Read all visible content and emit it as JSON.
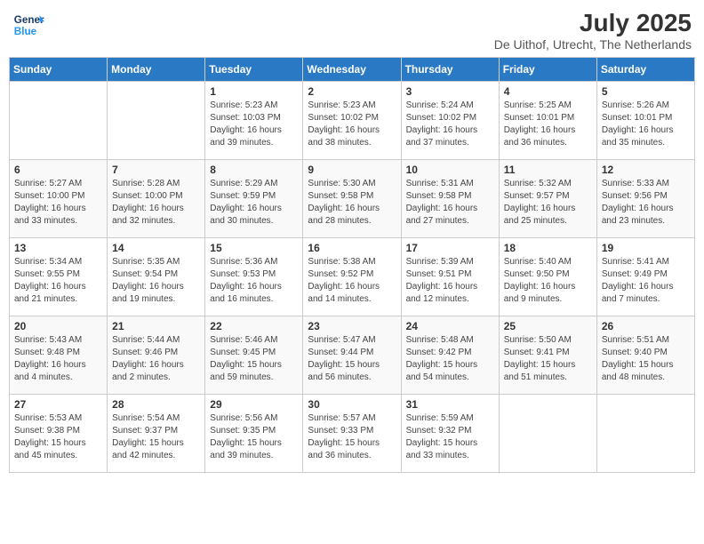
{
  "header": {
    "logo_line1": "General",
    "logo_line2": "Blue",
    "month_year": "July 2025",
    "location": "De Uithof, Utrecht, The Netherlands"
  },
  "days_of_week": [
    "Sunday",
    "Monday",
    "Tuesday",
    "Wednesday",
    "Thursday",
    "Friday",
    "Saturday"
  ],
  "weeks": [
    [
      {
        "day": "",
        "content": ""
      },
      {
        "day": "",
        "content": ""
      },
      {
        "day": "1",
        "content": "Sunrise: 5:23 AM\nSunset: 10:03 PM\nDaylight: 16 hours and 39 minutes."
      },
      {
        "day": "2",
        "content": "Sunrise: 5:23 AM\nSunset: 10:02 PM\nDaylight: 16 hours and 38 minutes."
      },
      {
        "day": "3",
        "content": "Sunrise: 5:24 AM\nSunset: 10:02 PM\nDaylight: 16 hours and 37 minutes."
      },
      {
        "day": "4",
        "content": "Sunrise: 5:25 AM\nSunset: 10:01 PM\nDaylight: 16 hours and 36 minutes."
      },
      {
        "day": "5",
        "content": "Sunrise: 5:26 AM\nSunset: 10:01 PM\nDaylight: 16 hours and 35 minutes."
      }
    ],
    [
      {
        "day": "6",
        "content": "Sunrise: 5:27 AM\nSunset: 10:00 PM\nDaylight: 16 hours and 33 minutes."
      },
      {
        "day": "7",
        "content": "Sunrise: 5:28 AM\nSunset: 10:00 PM\nDaylight: 16 hours and 32 minutes."
      },
      {
        "day": "8",
        "content": "Sunrise: 5:29 AM\nSunset: 9:59 PM\nDaylight: 16 hours and 30 minutes."
      },
      {
        "day": "9",
        "content": "Sunrise: 5:30 AM\nSunset: 9:58 PM\nDaylight: 16 hours and 28 minutes."
      },
      {
        "day": "10",
        "content": "Sunrise: 5:31 AM\nSunset: 9:58 PM\nDaylight: 16 hours and 27 minutes."
      },
      {
        "day": "11",
        "content": "Sunrise: 5:32 AM\nSunset: 9:57 PM\nDaylight: 16 hours and 25 minutes."
      },
      {
        "day": "12",
        "content": "Sunrise: 5:33 AM\nSunset: 9:56 PM\nDaylight: 16 hours and 23 minutes."
      }
    ],
    [
      {
        "day": "13",
        "content": "Sunrise: 5:34 AM\nSunset: 9:55 PM\nDaylight: 16 hours and 21 minutes."
      },
      {
        "day": "14",
        "content": "Sunrise: 5:35 AM\nSunset: 9:54 PM\nDaylight: 16 hours and 19 minutes."
      },
      {
        "day": "15",
        "content": "Sunrise: 5:36 AM\nSunset: 9:53 PM\nDaylight: 16 hours and 16 minutes."
      },
      {
        "day": "16",
        "content": "Sunrise: 5:38 AM\nSunset: 9:52 PM\nDaylight: 16 hours and 14 minutes."
      },
      {
        "day": "17",
        "content": "Sunrise: 5:39 AM\nSunset: 9:51 PM\nDaylight: 16 hours and 12 minutes."
      },
      {
        "day": "18",
        "content": "Sunrise: 5:40 AM\nSunset: 9:50 PM\nDaylight: 16 hours and 9 minutes."
      },
      {
        "day": "19",
        "content": "Sunrise: 5:41 AM\nSunset: 9:49 PM\nDaylight: 16 hours and 7 minutes."
      }
    ],
    [
      {
        "day": "20",
        "content": "Sunrise: 5:43 AM\nSunset: 9:48 PM\nDaylight: 16 hours and 4 minutes."
      },
      {
        "day": "21",
        "content": "Sunrise: 5:44 AM\nSunset: 9:46 PM\nDaylight: 16 hours and 2 minutes."
      },
      {
        "day": "22",
        "content": "Sunrise: 5:46 AM\nSunset: 9:45 PM\nDaylight: 15 hours and 59 minutes."
      },
      {
        "day": "23",
        "content": "Sunrise: 5:47 AM\nSunset: 9:44 PM\nDaylight: 15 hours and 56 minutes."
      },
      {
        "day": "24",
        "content": "Sunrise: 5:48 AM\nSunset: 9:42 PM\nDaylight: 15 hours and 54 minutes."
      },
      {
        "day": "25",
        "content": "Sunrise: 5:50 AM\nSunset: 9:41 PM\nDaylight: 15 hours and 51 minutes."
      },
      {
        "day": "26",
        "content": "Sunrise: 5:51 AM\nSunset: 9:40 PM\nDaylight: 15 hours and 48 minutes."
      }
    ],
    [
      {
        "day": "27",
        "content": "Sunrise: 5:53 AM\nSunset: 9:38 PM\nDaylight: 15 hours and 45 minutes."
      },
      {
        "day": "28",
        "content": "Sunrise: 5:54 AM\nSunset: 9:37 PM\nDaylight: 15 hours and 42 minutes."
      },
      {
        "day": "29",
        "content": "Sunrise: 5:56 AM\nSunset: 9:35 PM\nDaylight: 15 hours and 39 minutes."
      },
      {
        "day": "30",
        "content": "Sunrise: 5:57 AM\nSunset: 9:33 PM\nDaylight: 15 hours and 36 minutes."
      },
      {
        "day": "31",
        "content": "Sunrise: 5:59 AM\nSunset: 9:32 PM\nDaylight: 15 hours and 33 minutes."
      },
      {
        "day": "",
        "content": ""
      },
      {
        "day": "",
        "content": ""
      }
    ]
  ]
}
